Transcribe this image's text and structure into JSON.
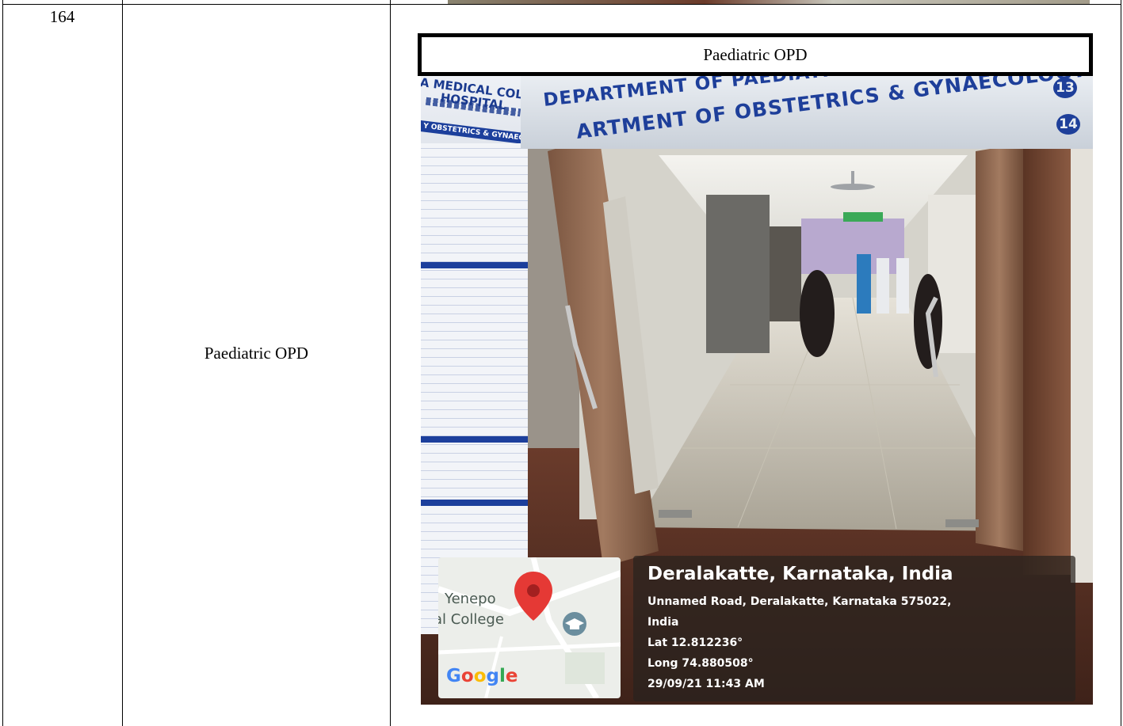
{
  "table_row": {
    "number": "164",
    "label": "Paediatric OPD",
    "caption": "Paediatric OPD"
  },
  "photo": {
    "left_sign": {
      "line1": "A MEDICAL COLLEGE",
      "line2": "HOSPITAL",
      "line3": "Y OBSTETRICS & GYNAECOLOGY O.P.D"
    },
    "department_sign": {
      "line1": "DEPARTMENT OF PAEDIATRICS",
      "line2": "ARTMENT OF OBSTETRICS & GYNAECOLOGY",
      "number1": "13",
      "number2": "14"
    },
    "map_overlay": {
      "place_line1": "Yenepo",
      "place_line2": "al College",
      "brand": "Google"
    },
    "geo_overlay": {
      "city": "Deralakatte, Karnataka, India",
      "address_line1": "Unnamed Road, Deralakatte, Karnataka 575022,",
      "address_line2": "India",
      "latitude": "Lat 12.812236°",
      "longitude": "Long 74.880508°",
      "timestamp": "29/09/21 11:43 AM"
    }
  },
  "colors": {
    "sign_blue": "#1e3f9a",
    "map_pin": "#e53935",
    "google_blue": "#4285f4",
    "google_red": "#ea4335",
    "google_yellow": "#fbbc05",
    "google_green": "#34a853"
  }
}
